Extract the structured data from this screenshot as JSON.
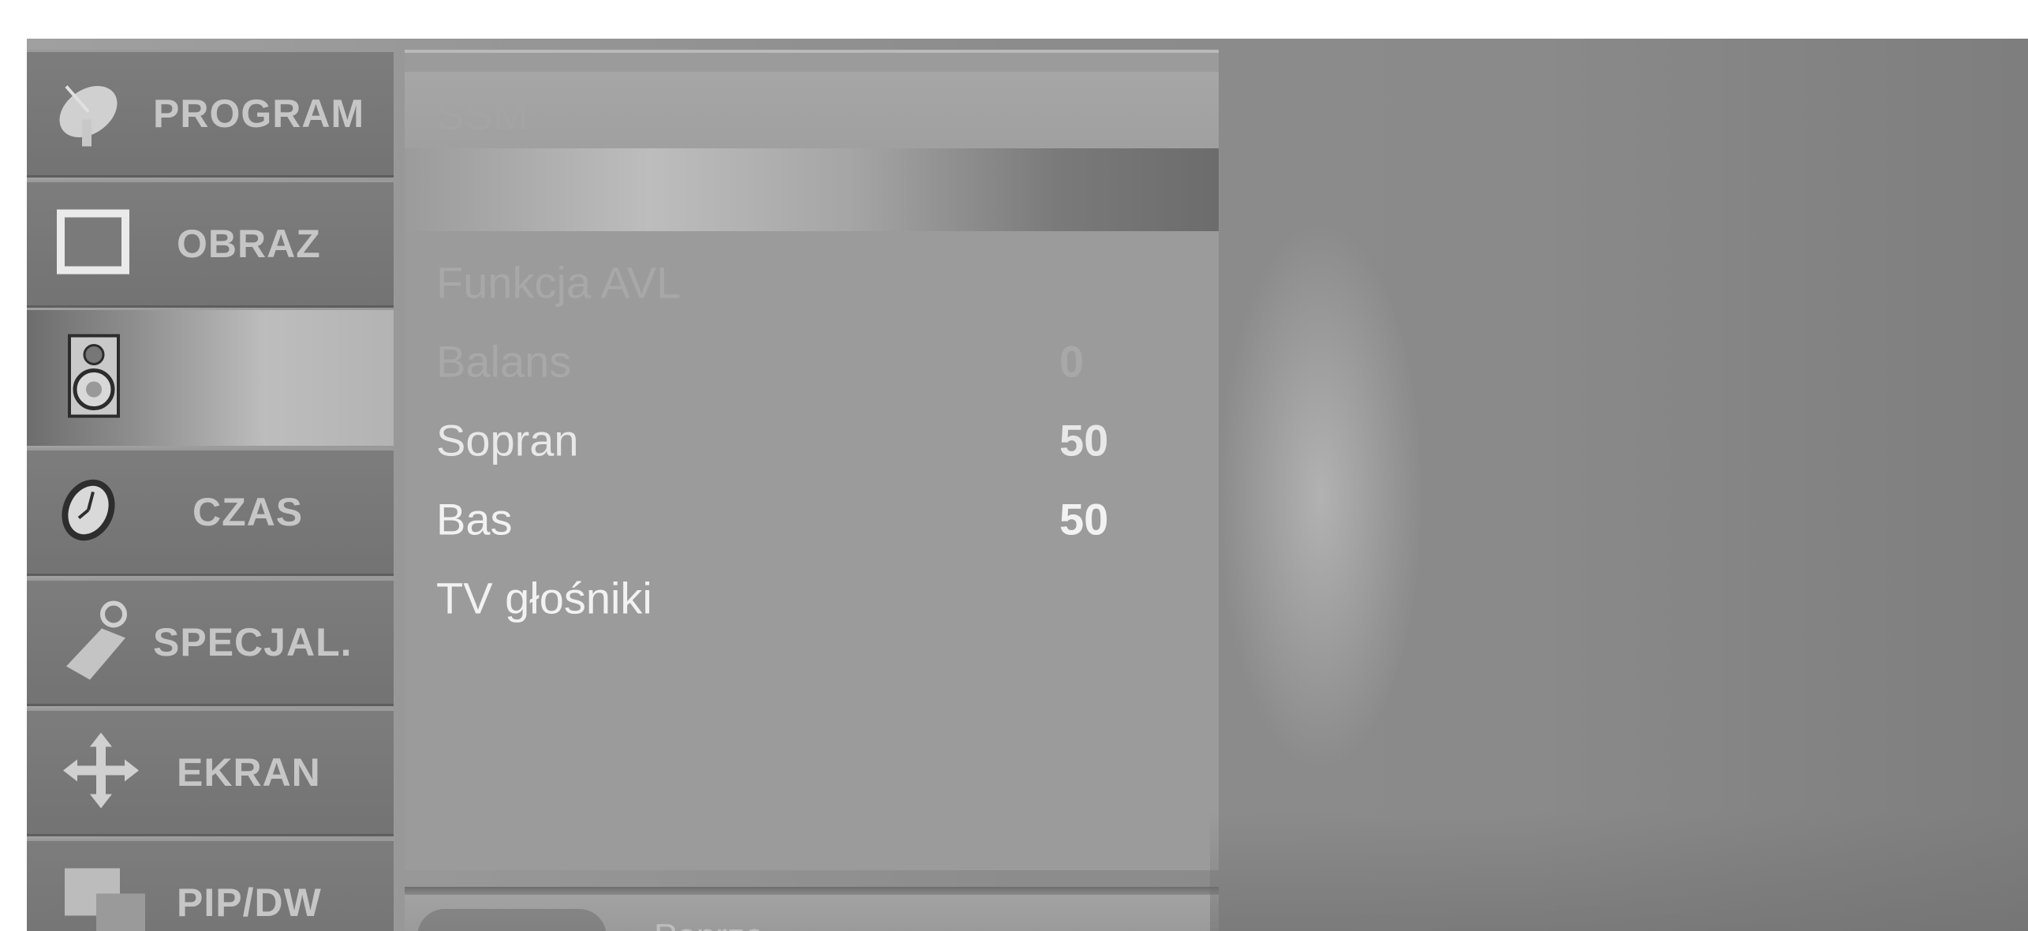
{
  "sidebar": {
    "items": [
      {
        "label": "PROGRAM",
        "icon": "satellite-dish-icon"
      },
      {
        "label": "OBRAZ",
        "icon": "picture-screen-icon"
      },
      {
        "label": "",
        "icon": "speaker-icon"
      },
      {
        "label": "CZAS",
        "icon": "clock-icon"
      },
      {
        "label": "SPECJAL.",
        "icon": "tag-icon"
      },
      {
        "label": "EKRAN",
        "icon": "move-arrows-icon"
      },
      {
        "label": "PIP/DW",
        "icon": "pip-icon"
      }
    ]
  },
  "menu": {
    "header": "SSM",
    "items": [
      {
        "label": "Funkcja AVL",
        "value": ""
      },
      {
        "label": "Balans",
        "value": "0"
      },
      {
        "label": "Sopran",
        "value": "50"
      },
      {
        "label": "Bas",
        "value": "50"
      },
      {
        "label": "TV głośniki",
        "value": ""
      }
    ]
  },
  "footer": {
    "prev_label": "Poprze."
  }
}
